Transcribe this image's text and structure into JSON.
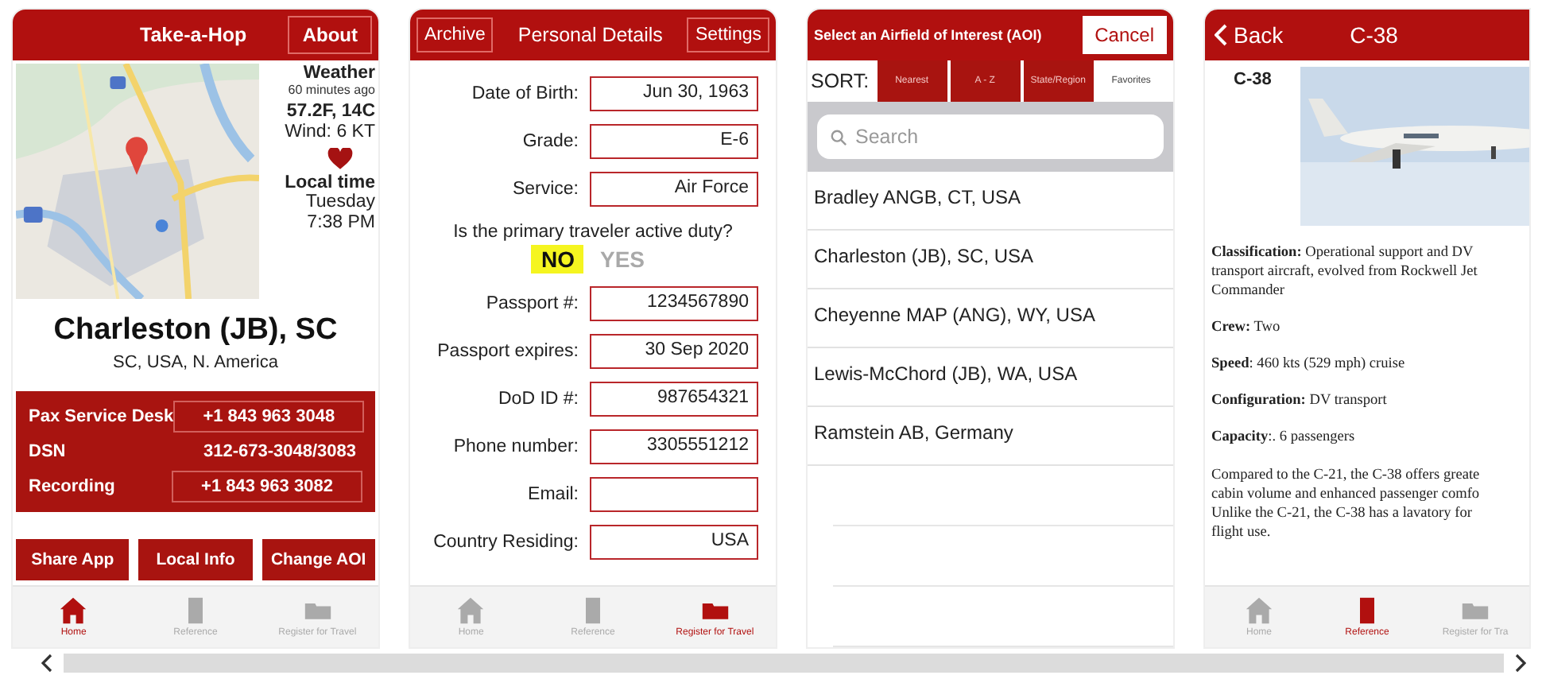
{
  "home_screen": {
    "header": {
      "title": "Take-a-Hop",
      "button": "About"
    },
    "weather": {
      "title": "Weather",
      "age": "60 minutes ago",
      "temperature": "57.2F, 14C",
      "wind": "Wind: 6 KT",
      "time_title": "Local time",
      "day": "Tuesday",
      "time": "7:38 PM"
    },
    "city": "Charleston (JB), SC",
    "region": "SC, USA, N. America",
    "contacts": [
      {
        "label": "Pax Service Desk",
        "value": "+1 843 963 3048",
        "kind": "link"
      },
      {
        "label": "DSN",
        "value": "312-673-3048/3083",
        "kind": "text"
      },
      {
        "label": "Recording",
        "value": "+1 843 963 3082",
        "kind": "link"
      }
    ],
    "buttons": [
      "Share App",
      "Local Info",
      "Change AOI"
    ],
    "tabs": [
      {
        "label": "Home",
        "selected": true
      },
      {
        "label": "Reference",
        "selected": false
      },
      {
        "label": "Register for Travel",
        "selected": false
      }
    ]
  },
  "details_screen": {
    "header": {
      "left": "Archive",
      "title": "Personal Details",
      "right": "Settings"
    },
    "fields_before": [
      {
        "label": "Date of Birth:",
        "value": "Jun 30, 1963"
      },
      {
        "label": "Grade:",
        "value": "E-6"
      },
      {
        "label": "Service:",
        "value": "Air Force"
      }
    ],
    "question": "Is the primary traveler active duty?",
    "options": [
      {
        "label": "NO",
        "selected": true
      },
      {
        "label": "YES",
        "selected": false
      }
    ],
    "fields_after": [
      {
        "label": "Passport #:",
        "value": "1234567890"
      },
      {
        "label": "Passport expires:",
        "value": "30 Sep 2020"
      },
      {
        "label": "DoD ID #:",
        "value": "987654321"
      },
      {
        "label": "Phone number:",
        "value": "3305551212"
      },
      {
        "label": "Email:"
      },
      {
        "label": "Country Residing:",
        "value": "USA"
      }
    ],
    "tabs": [
      {
        "label": "Home",
        "selected": false
      },
      {
        "label": "Reference",
        "selected": false
      },
      {
        "label": "Register for Travel",
        "selected": true
      }
    ]
  },
  "airfield_screen": {
    "header": {
      "title": "Select an Airfield of Interest (AOI)",
      "button": "Cancel"
    },
    "sort_label": "SORT:",
    "sort_options": [
      {
        "label": "Nearest",
        "selected": false
      },
      {
        "label": "A - Z",
        "selected": false
      },
      {
        "label": "State/Region",
        "selected": false
      },
      {
        "label": "Favorites",
        "selected": true
      }
    ],
    "search": {
      "placeholder": "Search"
    },
    "airfields": [
      "Bradley ANGB, CT, USA",
      "Charleston (JB), SC, USA",
      "Cheyenne MAP (ANG), WY, USA",
      "Lewis-McChord (JB), WA, USA",
      "Ramstein AB, Germany"
    ]
  },
  "aircraft_screen": {
    "header": {
      "back": "Back",
      "title": "C-38"
    },
    "name": "C-38",
    "paragraphs": [
      {
        "lines": [
          "**Classification:** Operational support and DV",
          "transport aircraft, evolved from Rockwell Jet",
          "Commander"
        ]
      },
      {
        "lines": [
          "**Crew:** Two"
        ]
      },
      {
        "lines": [
          "**Speed**: 460 kts (529 mph) cruise"
        ]
      },
      {
        "lines": [
          "**Configuration:** DV transport"
        ]
      },
      {
        "lines": [
          "**Capacity**:. 6 passengers"
        ]
      },
      {
        "lines": [
          "Compared to the C-21, the C-38 offers greate",
          "cabin volume and enhanced passenger comfo",
          "Unlike the C-21, the C-38 has a lavatory for",
          "flight use."
        ]
      }
    ],
    "tabs": [
      {
        "label": "Home",
        "selected": false
      },
      {
        "label": "Reference",
        "selected": true
      },
      {
        "label": "Register for Tra",
        "selected": false
      }
    ]
  }
}
